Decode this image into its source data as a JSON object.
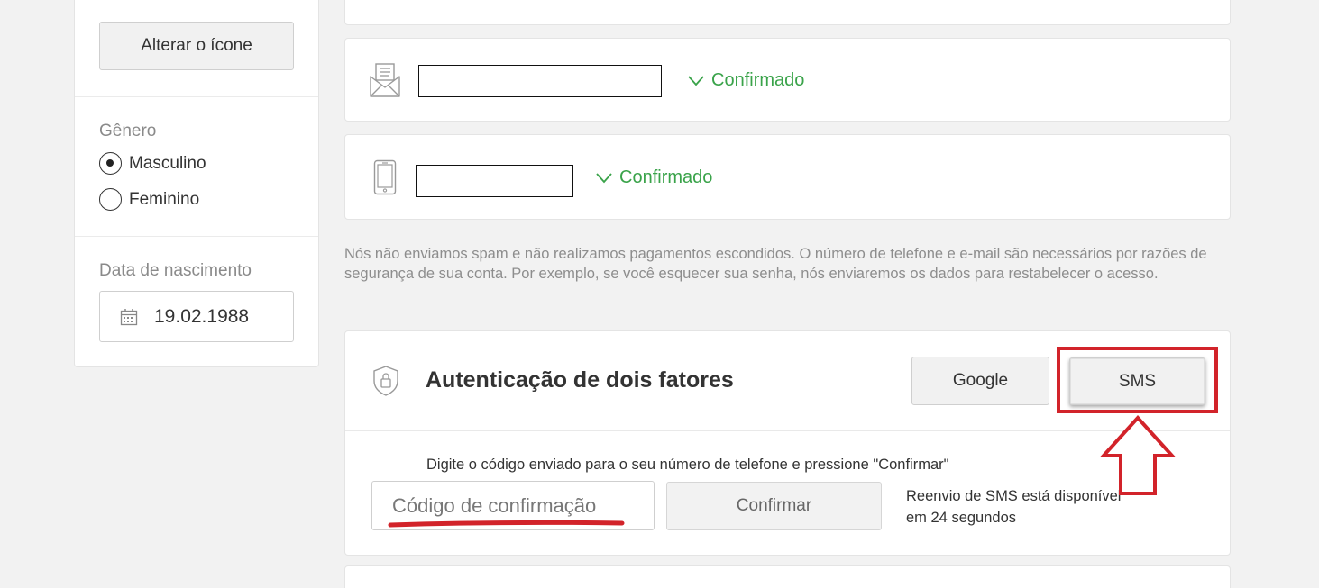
{
  "profile_sidebar": {
    "change_icon_label": "Alterar o ícone",
    "gender": {
      "label": "Gênero",
      "options": [
        {
          "label": "Masculino",
          "selected": true
        },
        {
          "label": "Feminino",
          "selected": false
        }
      ]
    },
    "birth_date": {
      "label": "Data de nascimento",
      "value": "19.02.1988",
      "icon": "calendar-icon"
    }
  },
  "contacts": {
    "email": {
      "icon": "envelope-icon",
      "value": "",
      "status": "Confirmado"
    },
    "phone": {
      "icon": "smartphone-icon",
      "value": "",
      "status": "Confirmado"
    }
  },
  "privacy_note": "Nós não enviamos spam e não realizamos pagamentos escondidos. O número de telefone e e-mail são necessários por razões de segurança de sua conta. Por exemplo, se você esquecer sua senha, nós enviaremos os dados para restabelecer o acesso.",
  "two_factor": {
    "icon": "shield-lock-icon",
    "title": "Autenticação de dois fatores",
    "methods": [
      "Google",
      "SMS"
    ],
    "selected_method": "SMS",
    "instruction": "Digite o código enviado para o seu número de telefone e pressione \"Confirmar\"",
    "code_placeholder": "Código de confirmação",
    "confirm_label": "Confirmar",
    "resend_text": "Reenvio de SMS está disponível em 24 segundos"
  },
  "colors": {
    "confirmed": "#3aa34a",
    "annotation": "#d2232a",
    "background": "#f2f2f2"
  }
}
